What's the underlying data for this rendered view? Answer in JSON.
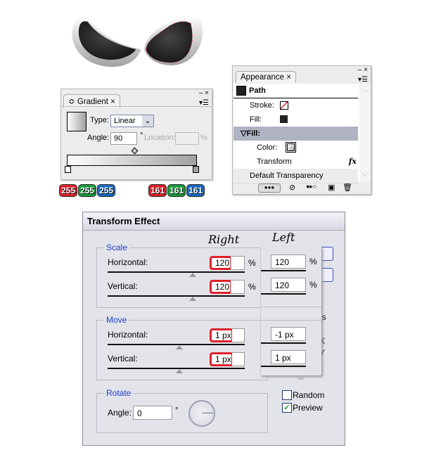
{
  "gradient_panel": {
    "tab": "Gradient",
    "type_label": "Type:",
    "type_value": "Linear",
    "angle_label": "Angle:",
    "angle_value": "90",
    "degree": "°",
    "location_label": "Location:",
    "location_value": "",
    "percent": "%"
  },
  "badges": {
    "left": [
      "255",
      "255",
      "255"
    ],
    "right": [
      "161",
      "161",
      "161"
    ],
    "colors": [
      "#e0202a",
      "#1a9a3a",
      "#1a6ac0"
    ]
  },
  "appearance_panel": {
    "tab": "Appearance",
    "path": "Path",
    "stroke": "Stroke:",
    "fill": "Fill:",
    "fill_group": "Fill:",
    "color": "Color:",
    "transform": "Transform",
    "fx": "fx",
    "default_transparency": "Default Transparency"
  },
  "dialog": {
    "title": "Transform Effect",
    "right_note": "Right",
    "left_note": "Left",
    "scale": {
      "label": "Scale",
      "horizontal": "Horizontal:",
      "vertical": "Vertical:",
      "h_right": "120",
      "v_right": "120",
      "h_left": "120",
      "v_left": "120",
      "unit": "%"
    },
    "move": {
      "label": "Move",
      "horizontal": "Horizontal:",
      "vertical": "Vertical:",
      "h_right": "1 px",
      "v_right": "1 px",
      "h_left": "-1 px",
      "v_left": "1 px"
    },
    "rotate": {
      "label": "Rotate",
      "angle_label": "Angle:",
      "angle_value": "0",
      "degree": "°"
    },
    "partial_es": "es",
    "partial_x": "X",
    "partial_y": "Y",
    "random": {
      "label": "Random",
      "checked": false
    },
    "preview": {
      "label": "Preview",
      "checked": true
    }
  },
  "colors": {
    "accent": "#1a3fcc",
    "highlight": "#e0202a"
  }
}
